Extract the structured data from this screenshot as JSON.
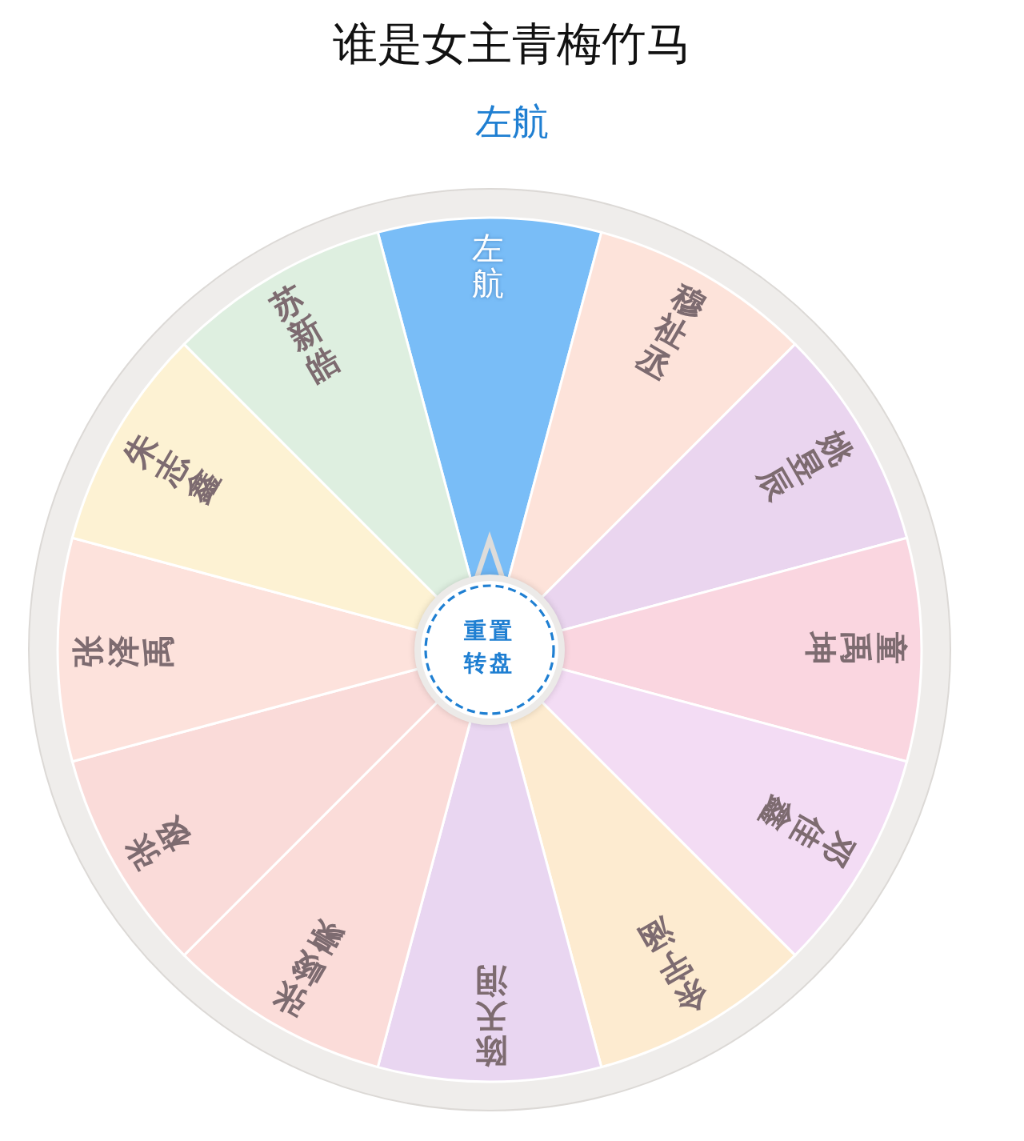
{
  "title": "谁是女主青梅竹马",
  "result": "左航",
  "wheel": {
    "segments": [
      {
        "label": "左航",
        "color": "#79bdf7",
        "selected": true
      },
      {
        "label": "穆祉丞",
        "color": "#fde3da",
        "selected": false
      },
      {
        "label": "姚昱辰",
        "color": "#ead5ef",
        "selected": false
      },
      {
        "label": "童禹坤",
        "color": "#fad6e0",
        "selected": false
      },
      {
        "label": "邓佳鑫",
        "color": "#f3dcf4",
        "selected": false
      },
      {
        "label": "余宇涵",
        "color": "#fdebd0",
        "selected": false
      },
      {
        "label": "陈天润",
        "color": "#e9d6f1",
        "selected": false
      },
      {
        "label": "张峻豪",
        "color": "#fbdcd9",
        "selected": false
      },
      {
        "label": "张极",
        "color": "#fadbd9",
        "selected": false
      },
      {
        "label": "张泽禹",
        "color": "#fde2dc",
        "selected": false
      },
      {
        "label": "朱志鑫",
        "color": "#fdf2d3",
        "selected": false
      },
      {
        "label": "苏新皓",
        "color": "#deefe0",
        "selected": false
      }
    ],
    "reset_button": "重置转盘"
  }
}
